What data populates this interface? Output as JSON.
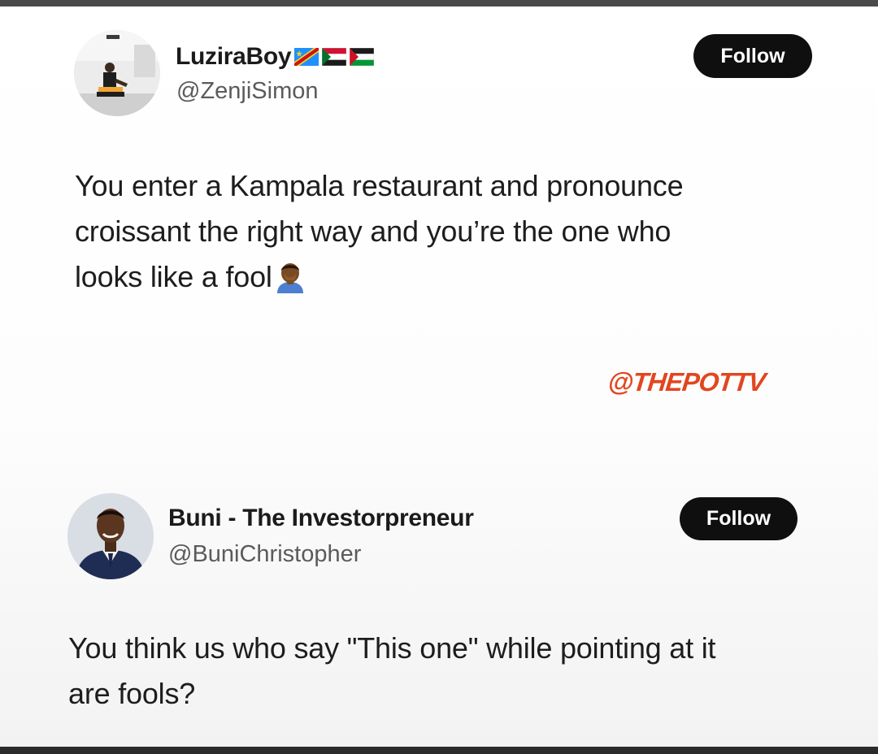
{
  "tweets": [
    {
      "display_name": "LuziraBoy",
      "flags": [
        "flag-dr-congo-icon",
        "flag-sudan-icon",
        "flag-palestine-icon"
      ],
      "handle": "@ZenjiSimon",
      "follow_label": "Follow",
      "body_lines": [
        "You enter a Kampala restaurant and pronounce",
        "croissant the right way and you’re the one who",
        "looks like a fool"
      ],
      "emoji": "person-facepalming-emoji"
    },
    {
      "display_name": "Buni - The Investorpreneur",
      "handle": "@BuniChristopher",
      "follow_label": "Follow",
      "body_lines": [
        "You think us who say \"This one\" while pointing at it",
        "are fools?"
      ]
    }
  ],
  "watermark": "@THEPOTTV",
  "colors": {
    "follow_button_bg": "#0f0f0f",
    "follow_button_text": "#ffffff",
    "watermark": "#e2461f",
    "handle": "#5b5b5b"
  }
}
